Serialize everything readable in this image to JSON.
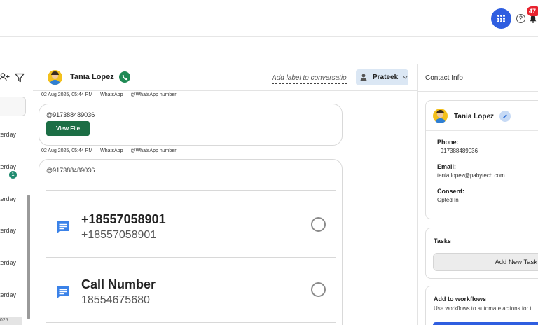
{
  "topbar": {
    "notification_count": "47",
    "help_glyph": "?",
    "icons": {
      "dialpad": "dialpad-icon",
      "help": "help-icon",
      "bell": "bell-icon"
    },
    "accent_color": "#2f5ee0",
    "badge_color": "#e8222e"
  },
  "left_list": {
    "items": [
      {
        "time": "terday"
      },
      {
        "time": "terday",
        "unread": "1"
      },
      {
        "time": "terday"
      },
      {
        "time": "terday"
      },
      {
        "time": "terday"
      },
      {
        "time": "terday"
      }
    ],
    "bottom_chip": "2025"
  },
  "conversation": {
    "contact_name": "Tania Lopez",
    "label_placeholder": "Add label to conversation",
    "assignee": "Prateek",
    "messages": [
      {
        "date": "02 Aug 2025, 05:44 PM",
        "channel": "WhatsApp",
        "handle": "@WhatsApp number",
        "phone": "@917388489036",
        "button": "View File"
      },
      {
        "date": "02 Aug 2025, 05:44 PM",
        "channel": "WhatsApp",
        "handle": "@WhatsApp number",
        "phone": "@917388489036",
        "options": [
          {
            "title": "+18557058901",
            "subtitle": "+18557058901"
          },
          {
            "title": "Call Number",
            "subtitle": "18554675680"
          }
        ]
      }
    ]
  },
  "contact_info": {
    "title": "Contact Info",
    "name": "Tania Lopez",
    "fields": [
      {
        "label": "Phone:",
        "value": "+917388489036"
      },
      {
        "label": "Email:",
        "value": "tania.lopez@pabytech.com"
      },
      {
        "label": "Consent:",
        "value": "Opted In"
      }
    ],
    "tasks": {
      "heading": "Tasks",
      "button": "Add New Task"
    },
    "workflows": {
      "heading": "Add to workflows",
      "subtitle": "Use workflows to automate actions for t"
    }
  }
}
